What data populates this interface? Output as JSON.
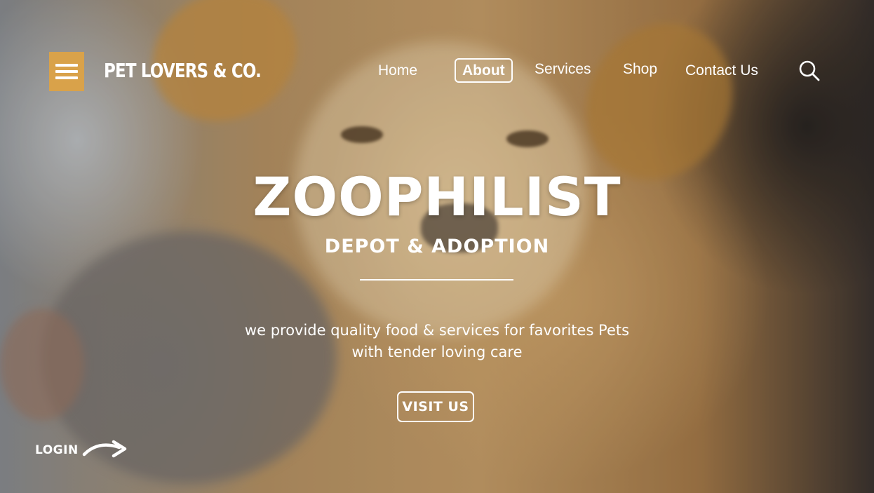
{
  "brand": {
    "name": "PET LOVERS & CO."
  },
  "nav": {
    "items": [
      {
        "label": "Home"
      },
      {
        "label": "About",
        "active": true
      },
      {
        "label": "Services"
      },
      {
        "label": "Shop"
      },
      {
        "label": "Contact Us"
      }
    ]
  },
  "icons": {
    "menu": "hamburger-menu-icon",
    "search": "search-icon",
    "login_arrow": "curved-arrow-icon"
  },
  "hero": {
    "title": "ZOOPHILIST",
    "subtitle": "DEPOT & ADOPTION",
    "tagline_line1": "we provide quality food & services for favorites Pets",
    "tagline_line2": "with tender loving care",
    "cta": "VISIT US"
  },
  "login": {
    "label": "LOGIN"
  },
  "colors": {
    "accent": "#d9a24a",
    "text": "#ffffff"
  }
}
